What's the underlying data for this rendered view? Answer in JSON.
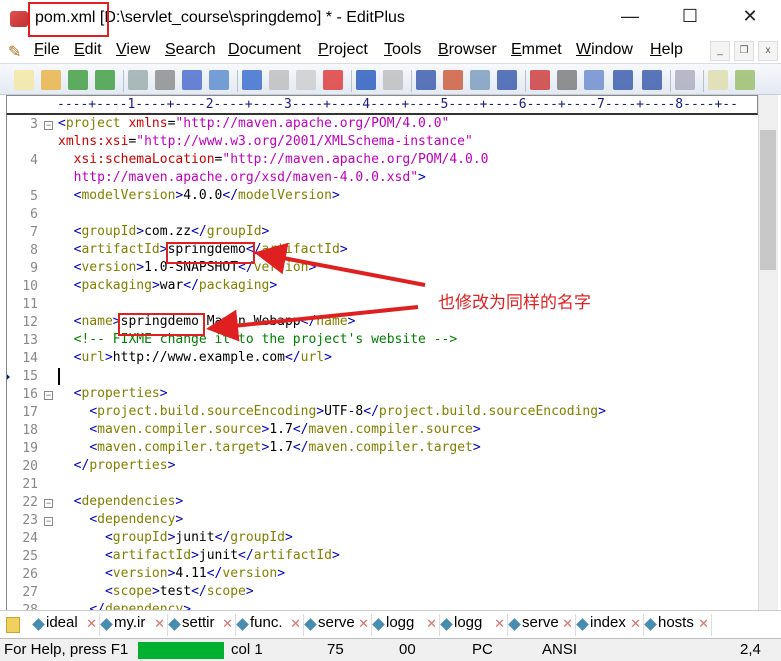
{
  "window": {
    "title": "pom.xml [D:\\servlet_course\\springdemo] * - EditPlus",
    "minimize": "—",
    "maximize": "☐",
    "close": "✕"
  },
  "menu": [
    "File",
    "Edit",
    "View",
    "Search",
    "Document",
    "Project",
    "Tools",
    "Browser",
    "Emmet",
    "Window",
    "Help"
  ],
  "mdi": [
    "_",
    "❐",
    "x"
  ],
  "toolbar": [
    "new",
    "open",
    "save",
    "save-all",
    "print-preview",
    "print",
    "spell-check",
    "browser-preview",
    "cut",
    "copy",
    "paste",
    "delete",
    "undo",
    "redo",
    "find",
    "replace",
    "goto",
    "line-numbers",
    "font-size",
    "hex",
    "word-wrap",
    "indent",
    "column-select",
    "settings",
    "panel1",
    "panel2"
  ],
  "ruler": "----+----1----+----2----+----3----+----4----+----5----+----6----+----7----+----8----+--",
  "editor": {
    "cursor_line": "15",
    "rows": [
      {
        "n": "3",
        "f": 1,
        "i": 0,
        "s": [
          [
            "b",
            "<"
          ],
          [
            "t",
            "project "
          ],
          [
            "a",
            "xmlns"
          ],
          [
            "x",
            "="
          ],
          [
            "v",
            "\"http://maven.apache.org/POM/4.0.0\""
          ]
        ]
      },
      {
        "n": "",
        "i": 0,
        "s": [
          [
            "a",
            "xmlns:xsi"
          ],
          [
            "x",
            "="
          ],
          [
            "v",
            "\"http://www.w3.org/2001/XMLSchema-instance\""
          ]
        ]
      },
      {
        "n": "4",
        "i": 2,
        "s": [
          [
            "a",
            "xsi:schemaLocation"
          ],
          [
            "x",
            "="
          ],
          [
            "v",
            "\"http://maven.apache.org/POM/4.0.0"
          ]
        ]
      },
      {
        "n": "",
        "i": 2,
        "s": [
          [
            "v",
            "http://maven.apache.org/xsd/maven-4.0.0.xsd\""
          ],
          [
            "b",
            ">"
          ]
        ]
      },
      {
        "n": "5",
        "i": 2,
        "s": [
          [
            "b",
            "<"
          ],
          [
            "t",
            "modelVersion"
          ],
          [
            "b",
            ">"
          ],
          [
            "x",
            "4.0.0"
          ],
          [
            "b",
            "</"
          ],
          [
            "t",
            "modelVersion"
          ],
          [
            "b",
            ">"
          ]
        ]
      },
      {
        "n": "6",
        "i": 0,
        "s": []
      },
      {
        "n": "7",
        "i": 2,
        "s": [
          [
            "b",
            "<"
          ],
          [
            "t",
            "groupId"
          ],
          [
            "b",
            ">"
          ],
          [
            "x",
            "com.zz"
          ],
          [
            "b",
            "</"
          ],
          [
            "t",
            "groupId"
          ],
          [
            "b",
            ">"
          ]
        ]
      },
      {
        "n": "8",
        "i": 2,
        "s": [
          [
            "b",
            "<"
          ],
          [
            "t",
            "artifactId"
          ],
          [
            "b",
            ">"
          ],
          [
            "x",
            "springdemo"
          ],
          [
            "b",
            "</"
          ],
          [
            "t",
            "artifactId"
          ],
          [
            "b",
            ">"
          ]
        ]
      },
      {
        "n": "9",
        "i": 2,
        "s": [
          [
            "b",
            "<"
          ],
          [
            "t",
            "version"
          ],
          [
            "b",
            ">"
          ],
          [
            "x",
            "1.0-SNAPSHOT"
          ],
          [
            "b",
            "</"
          ],
          [
            "t",
            "version"
          ],
          [
            "b",
            ">"
          ]
        ]
      },
      {
        "n": "10",
        "i": 2,
        "s": [
          [
            "b",
            "<"
          ],
          [
            "t",
            "packaging"
          ],
          [
            "b",
            ">"
          ],
          [
            "x",
            "war"
          ],
          [
            "b",
            "</"
          ],
          [
            "t",
            "packaging"
          ],
          [
            "b",
            ">"
          ]
        ]
      },
      {
        "n": "11",
        "i": 0,
        "s": []
      },
      {
        "n": "12",
        "i": 2,
        "s": [
          [
            "b",
            "<"
          ],
          [
            "t",
            "name"
          ],
          [
            "b",
            ">"
          ],
          [
            "x",
            "springdemo Maven Webapp"
          ],
          [
            "b",
            "</"
          ],
          [
            "t",
            "name"
          ],
          [
            "b",
            ">"
          ]
        ]
      },
      {
        "n": "13",
        "i": 2,
        "s": [
          [
            "c",
            "<!-- FIXME change it to the project's website -->"
          ]
        ]
      },
      {
        "n": "14",
        "i": 2,
        "s": [
          [
            "b",
            "<"
          ],
          [
            "t",
            "url"
          ],
          [
            "b",
            ">"
          ],
          [
            "x",
            "http://www.example.com"
          ],
          [
            "b",
            "</"
          ],
          [
            "t",
            "url"
          ],
          [
            "b",
            ">"
          ]
        ]
      },
      {
        "n": "15",
        "i": 0,
        "s": []
      },
      {
        "n": "16",
        "f": 1,
        "i": 2,
        "s": [
          [
            "b",
            "<"
          ],
          [
            "t",
            "properties"
          ],
          [
            "b",
            ">"
          ]
        ]
      },
      {
        "n": "17",
        "i": 4,
        "s": [
          [
            "b",
            "<"
          ],
          [
            "t",
            "project.build.sourceEncoding"
          ],
          [
            "b",
            ">"
          ],
          [
            "x",
            "UTF-8"
          ],
          [
            "b",
            "</"
          ],
          [
            "t",
            "project.build.sourceEncoding"
          ],
          [
            "b",
            ">"
          ]
        ]
      },
      {
        "n": "18",
        "i": 4,
        "s": [
          [
            "b",
            "<"
          ],
          [
            "t",
            "maven.compiler.source"
          ],
          [
            "b",
            ">"
          ],
          [
            "x",
            "1.7"
          ],
          [
            "b",
            "</"
          ],
          [
            "t",
            "maven.compiler.source"
          ],
          [
            "b",
            ">"
          ]
        ]
      },
      {
        "n": "19",
        "i": 4,
        "s": [
          [
            "b",
            "<"
          ],
          [
            "t",
            "maven.compiler.target"
          ],
          [
            "b",
            ">"
          ],
          [
            "x",
            "1.7"
          ],
          [
            "b",
            "</"
          ],
          [
            "t",
            "maven.compiler.target"
          ],
          [
            "b",
            ">"
          ]
        ]
      },
      {
        "n": "20",
        "i": 2,
        "s": [
          [
            "b",
            "</"
          ],
          [
            "t",
            "properties"
          ],
          [
            "b",
            ">"
          ]
        ]
      },
      {
        "n": "21",
        "i": 0,
        "s": []
      },
      {
        "n": "22",
        "f": 1,
        "i": 2,
        "s": [
          [
            "b",
            "<"
          ],
          [
            "t",
            "dependencies"
          ],
          [
            "b",
            ">"
          ]
        ]
      },
      {
        "n": "23",
        "f": 1,
        "i": 4,
        "s": [
          [
            "b",
            "<"
          ],
          [
            "t",
            "dependency"
          ],
          [
            "b",
            ">"
          ]
        ]
      },
      {
        "n": "24",
        "i": 6,
        "s": [
          [
            "b",
            "<"
          ],
          [
            "t",
            "groupId"
          ],
          [
            "b",
            ">"
          ],
          [
            "x",
            "junit"
          ],
          [
            "b",
            "</"
          ],
          [
            "t",
            "groupId"
          ],
          [
            "b",
            ">"
          ]
        ]
      },
      {
        "n": "25",
        "i": 6,
        "s": [
          [
            "b",
            "<"
          ],
          [
            "t",
            "artifactId"
          ],
          [
            "b",
            ">"
          ],
          [
            "x",
            "junit"
          ],
          [
            "b",
            "</"
          ],
          [
            "t",
            "artifactId"
          ],
          [
            "b",
            ">"
          ]
        ]
      },
      {
        "n": "26",
        "i": 6,
        "s": [
          [
            "b",
            "<"
          ],
          [
            "t",
            "version"
          ],
          [
            "b",
            ">"
          ],
          [
            "x",
            "4.11"
          ],
          [
            "b",
            "</"
          ],
          [
            "t",
            "version"
          ],
          [
            "b",
            ">"
          ]
        ]
      },
      {
        "n": "27",
        "i": 6,
        "s": [
          [
            "b",
            "<"
          ],
          [
            "t",
            "scope"
          ],
          [
            "b",
            ">"
          ],
          [
            "x",
            "test"
          ],
          [
            "b",
            "</"
          ],
          [
            "t",
            "scope"
          ],
          [
            "b",
            ">"
          ]
        ]
      },
      {
        "n": "28",
        "i": 4,
        "s": [
          [
            "b",
            "</"
          ],
          [
            "t",
            "dependency"
          ],
          [
            "b",
            ">"
          ]
        ]
      }
    ]
  },
  "annotation": {
    "note": "也修改为同样的名字",
    "color": "#e02020"
  },
  "tabs": [
    "ideal",
    "my.ir",
    "settir",
    "func.",
    "serve",
    "logg",
    "logg",
    "serve",
    "index",
    "hosts"
  ],
  "status": {
    "help": "For Help, press F1",
    "col": "col 1",
    "lines": "75",
    "code": "00",
    "mode": "PC",
    "encoding": "ANSI",
    "pos": "2,4",
    "progress_color": "#00b030"
  }
}
